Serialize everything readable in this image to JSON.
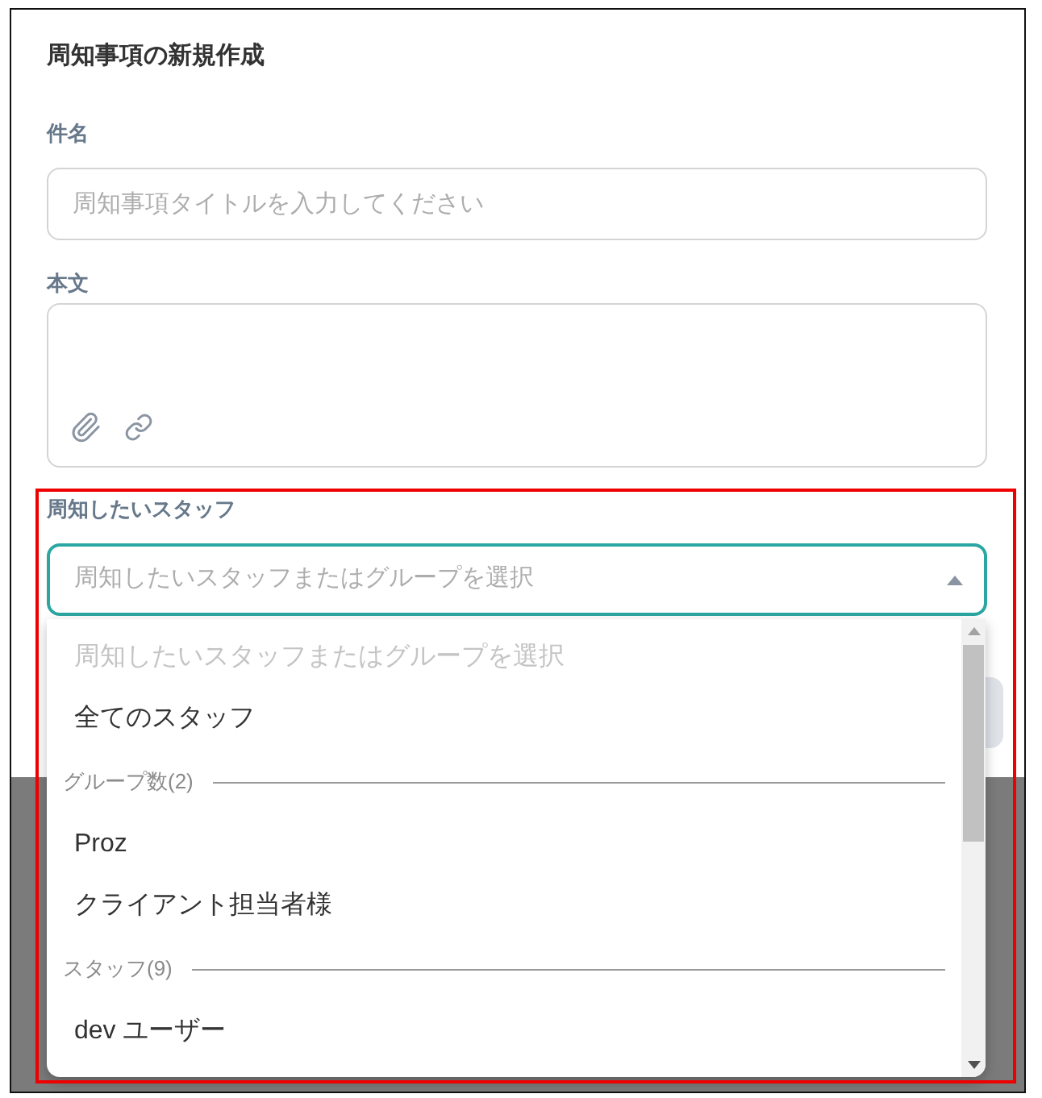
{
  "dialog": {
    "title": "周知事項の新規作成"
  },
  "fields": [
    {
      "kind": "text",
      "label": "件名",
      "placeholder": "周知事項タイトルを入力してください"
    },
    {
      "kind": "textarea",
      "label": "本文"
    }
  ],
  "staff_select": {
    "label": "周知したいスタッフ",
    "placeholder": "周知したいスタッフまたはグループを選択",
    "expanded": true,
    "options": [
      {
        "kind": "option",
        "label": "周知したいスタッフまたはグループを選択",
        "disabled": true
      },
      {
        "kind": "option",
        "label": "全てのスタッフ",
        "disabled": false
      },
      {
        "kind": "group",
        "label": "グループ数(2)"
      },
      {
        "kind": "option",
        "label": "Proz",
        "disabled": false
      },
      {
        "kind": "option",
        "label": "クライアント担当者様",
        "disabled": false
      },
      {
        "kind": "group",
        "label": "スタッフ(9)"
      },
      {
        "kind": "option",
        "label": "dev ユーザー",
        "disabled": false
      }
    ]
  }
}
